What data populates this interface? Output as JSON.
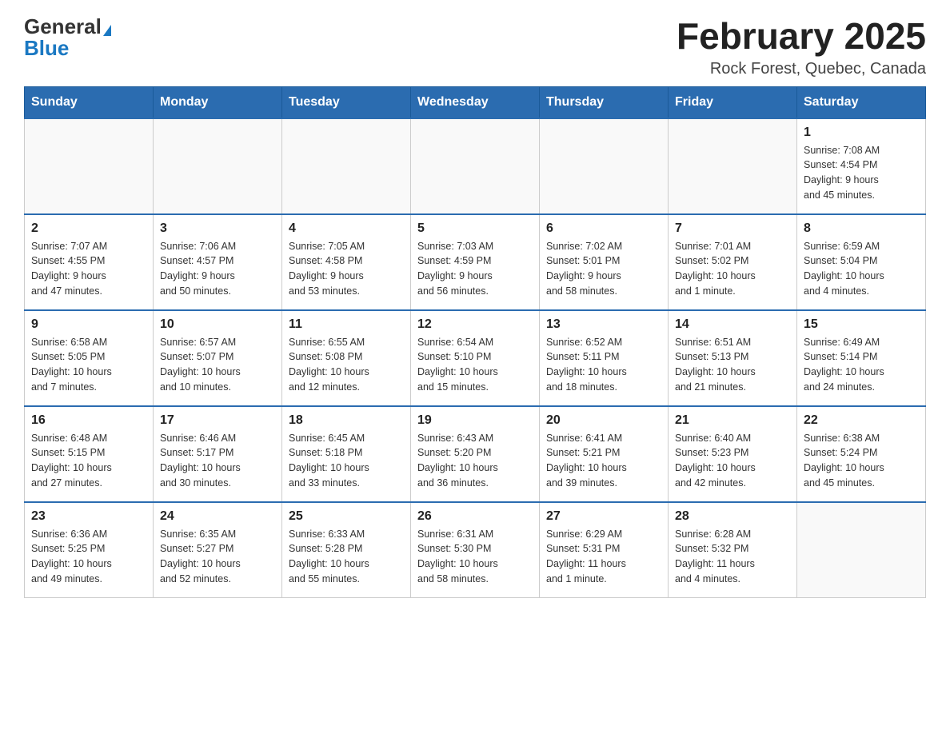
{
  "logo": {
    "general": "General",
    "blue": "Blue"
  },
  "header": {
    "month": "February 2025",
    "location": "Rock Forest, Quebec, Canada"
  },
  "weekdays": [
    "Sunday",
    "Monday",
    "Tuesday",
    "Wednesday",
    "Thursday",
    "Friday",
    "Saturday"
  ],
  "weeks": [
    [
      {
        "day": "",
        "info": ""
      },
      {
        "day": "",
        "info": ""
      },
      {
        "day": "",
        "info": ""
      },
      {
        "day": "",
        "info": ""
      },
      {
        "day": "",
        "info": ""
      },
      {
        "day": "",
        "info": ""
      },
      {
        "day": "1",
        "info": "Sunrise: 7:08 AM\nSunset: 4:54 PM\nDaylight: 9 hours\nand 45 minutes."
      }
    ],
    [
      {
        "day": "2",
        "info": "Sunrise: 7:07 AM\nSunset: 4:55 PM\nDaylight: 9 hours\nand 47 minutes."
      },
      {
        "day": "3",
        "info": "Sunrise: 7:06 AM\nSunset: 4:57 PM\nDaylight: 9 hours\nand 50 minutes."
      },
      {
        "day": "4",
        "info": "Sunrise: 7:05 AM\nSunset: 4:58 PM\nDaylight: 9 hours\nand 53 minutes."
      },
      {
        "day": "5",
        "info": "Sunrise: 7:03 AM\nSunset: 4:59 PM\nDaylight: 9 hours\nand 56 minutes."
      },
      {
        "day": "6",
        "info": "Sunrise: 7:02 AM\nSunset: 5:01 PM\nDaylight: 9 hours\nand 58 minutes."
      },
      {
        "day": "7",
        "info": "Sunrise: 7:01 AM\nSunset: 5:02 PM\nDaylight: 10 hours\nand 1 minute."
      },
      {
        "day": "8",
        "info": "Sunrise: 6:59 AM\nSunset: 5:04 PM\nDaylight: 10 hours\nand 4 minutes."
      }
    ],
    [
      {
        "day": "9",
        "info": "Sunrise: 6:58 AM\nSunset: 5:05 PM\nDaylight: 10 hours\nand 7 minutes."
      },
      {
        "day": "10",
        "info": "Sunrise: 6:57 AM\nSunset: 5:07 PM\nDaylight: 10 hours\nand 10 minutes."
      },
      {
        "day": "11",
        "info": "Sunrise: 6:55 AM\nSunset: 5:08 PM\nDaylight: 10 hours\nand 12 minutes."
      },
      {
        "day": "12",
        "info": "Sunrise: 6:54 AM\nSunset: 5:10 PM\nDaylight: 10 hours\nand 15 minutes."
      },
      {
        "day": "13",
        "info": "Sunrise: 6:52 AM\nSunset: 5:11 PM\nDaylight: 10 hours\nand 18 minutes."
      },
      {
        "day": "14",
        "info": "Sunrise: 6:51 AM\nSunset: 5:13 PM\nDaylight: 10 hours\nand 21 minutes."
      },
      {
        "day": "15",
        "info": "Sunrise: 6:49 AM\nSunset: 5:14 PM\nDaylight: 10 hours\nand 24 minutes."
      }
    ],
    [
      {
        "day": "16",
        "info": "Sunrise: 6:48 AM\nSunset: 5:15 PM\nDaylight: 10 hours\nand 27 minutes."
      },
      {
        "day": "17",
        "info": "Sunrise: 6:46 AM\nSunset: 5:17 PM\nDaylight: 10 hours\nand 30 minutes."
      },
      {
        "day": "18",
        "info": "Sunrise: 6:45 AM\nSunset: 5:18 PM\nDaylight: 10 hours\nand 33 minutes."
      },
      {
        "day": "19",
        "info": "Sunrise: 6:43 AM\nSunset: 5:20 PM\nDaylight: 10 hours\nand 36 minutes."
      },
      {
        "day": "20",
        "info": "Sunrise: 6:41 AM\nSunset: 5:21 PM\nDaylight: 10 hours\nand 39 minutes."
      },
      {
        "day": "21",
        "info": "Sunrise: 6:40 AM\nSunset: 5:23 PM\nDaylight: 10 hours\nand 42 minutes."
      },
      {
        "day": "22",
        "info": "Sunrise: 6:38 AM\nSunset: 5:24 PM\nDaylight: 10 hours\nand 45 minutes."
      }
    ],
    [
      {
        "day": "23",
        "info": "Sunrise: 6:36 AM\nSunset: 5:25 PM\nDaylight: 10 hours\nand 49 minutes."
      },
      {
        "day": "24",
        "info": "Sunrise: 6:35 AM\nSunset: 5:27 PM\nDaylight: 10 hours\nand 52 minutes."
      },
      {
        "day": "25",
        "info": "Sunrise: 6:33 AM\nSunset: 5:28 PM\nDaylight: 10 hours\nand 55 minutes."
      },
      {
        "day": "26",
        "info": "Sunrise: 6:31 AM\nSunset: 5:30 PM\nDaylight: 10 hours\nand 58 minutes."
      },
      {
        "day": "27",
        "info": "Sunrise: 6:29 AM\nSunset: 5:31 PM\nDaylight: 11 hours\nand 1 minute."
      },
      {
        "day": "28",
        "info": "Sunrise: 6:28 AM\nSunset: 5:32 PM\nDaylight: 11 hours\nand 4 minutes."
      },
      {
        "day": "",
        "info": ""
      }
    ]
  ]
}
